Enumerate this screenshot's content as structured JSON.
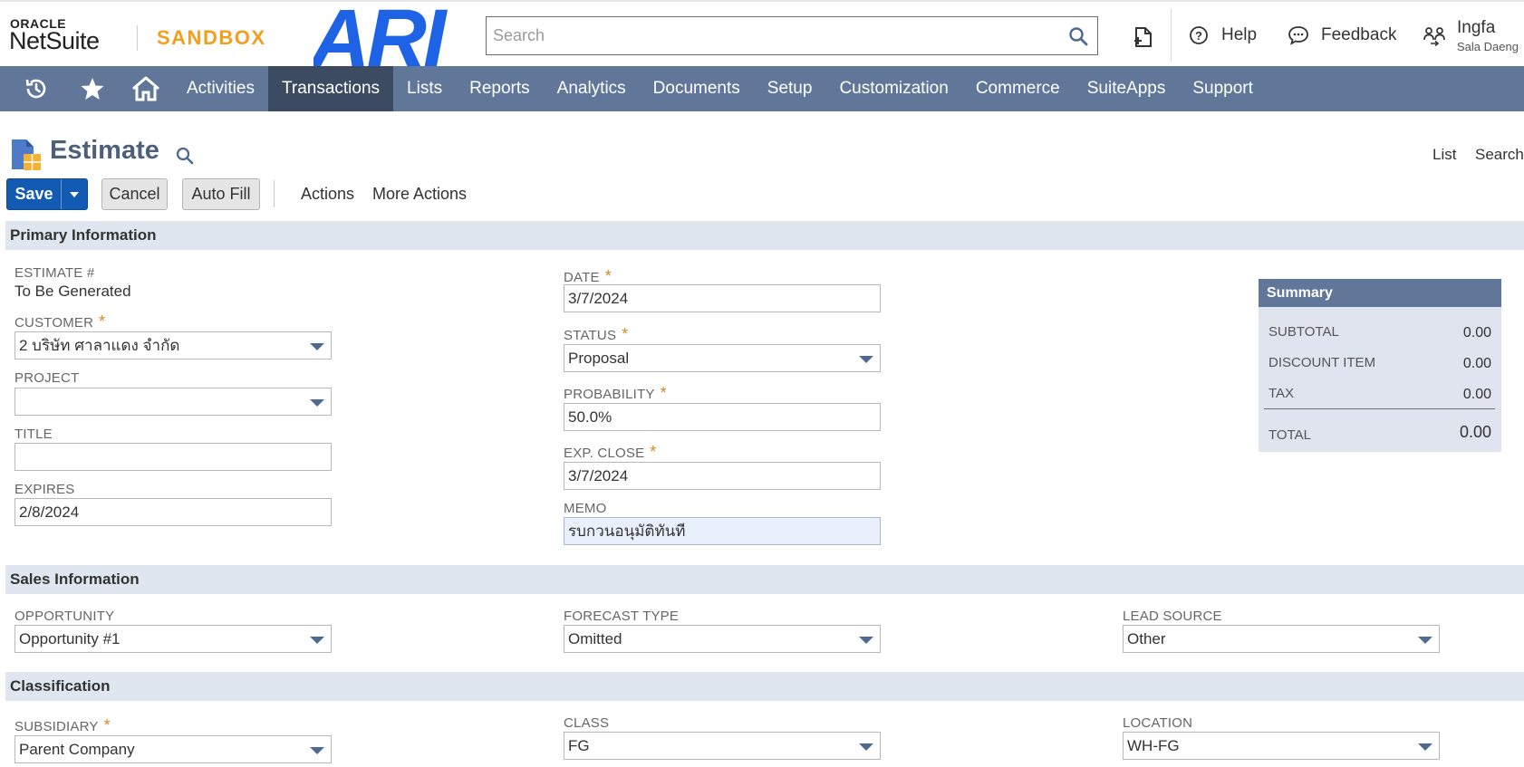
{
  "header": {
    "logo_oracle": "ORACLE",
    "logo_netsuite": "NetSuite",
    "logo_sandbox": "SANDBOX",
    "brand_text": "ARI",
    "search_placeholder": "Search",
    "help_label": "Help",
    "feedback_label": "Feedback",
    "user_name": "Ingfa",
    "user_subsidiary": "Sala Daeng"
  },
  "nav": {
    "tabs": [
      "Activities",
      "Transactions",
      "Lists",
      "Reports",
      "Analytics",
      "Documents",
      "Setup",
      "Customization",
      "Commerce",
      "SuiteApps",
      "Support"
    ],
    "active_tab": "Transactions"
  },
  "page": {
    "title": "Estimate",
    "list_link": "List",
    "search_link": "Search"
  },
  "toolbar": {
    "save_label": "Save",
    "cancel_label": "Cancel",
    "autofill_label": "Auto Fill",
    "actions_label": "Actions",
    "more_actions_label": "More Actions"
  },
  "sections": {
    "primary": "Primary Information",
    "sales": "Sales Information",
    "classification": "Classification"
  },
  "primary": {
    "estimate_label": "ESTIMATE #",
    "estimate_value": "To Be Generated",
    "customer_label": "CUSTOMER",
    "customer_value": "2 บริษัท ศาลาแดง จำกัด",
    "project_label": "PROJECT",
    "project_value": "",
    "title_label": "TITLE",
    "title_value": "",
    "expires_label": "EXPIRES",
    "expires_value": "2/8/2024",
    "date_label": "DATE",
    "date_value": "3/7/2024",
    "status_label": "STATUS",
    "status_value": "Proposal",
    "probability_label": "PROBABILITY",
    "probability_value": "50.0%",
    "exp_close_label": "EXP. CLOSE",
    "exp_close_value": "3/7/2024",
    "memo_label": "MEMO",
    "memo_value": "รบกวนอนุมัติทันที"
  },
  "summary": {
    "title": "Summary",
    "subtotal_label": "SUBTOTAL",
    "subtotal_value": "0.00",
    "discount_label": "DISCOUNT ITEM",
    "discount_value": "0.00",
    "tax_label": "TAX",
    "tax_value": "0.00",
    "total_label": "TOTAL",
    "total_value": "0.00"
  },
  "sales": {
    "opportunity_label": "OPPORTUNITY",
    "opportunity_value": "Opportunity #1",
    "forecast_label": "FORECAST TYPE",
    "forecast_value": "Omitted",
    "lead_label": "LEAD SOURCE",
    "lead_value": "Other"
  },
  "classification": {
    "subsidiary_label": "SUBSIDIARY",
    "subsidiary_value": "Parent Company",
    "class_label": "CLASS",
    "class_value": "FG",
    "location_label": "LOCATION",
    "location_value": "WH-FG"
  },
  "colors": {
    "nav_bg": "#607799",
    "nav_active": "#3c4b62",
    "save_blue": "#125ab2",
    "sandbox_orange": "#f29f1f",
    "brand_blue": "#1e63e6",
    "required_star": "#d08c22",
    "section_bg": "#e0e6ef"
  }
}
